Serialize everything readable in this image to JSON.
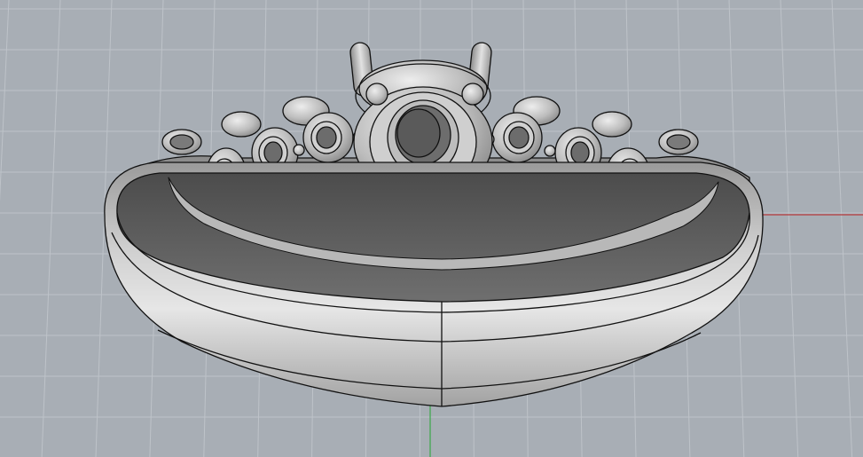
{
  "viewport": {
    "background": "#a8aeb5",
    "grid": true,
    "grid_color": "#bec3c9",
    "x_axis_color": "#b5383a",
    "y_axis_color": "#3aa84a"
  },
  "model": {
    "name": "solitaire-ring-with-side-stones",
    "shade_light": "#dcdcdc",
    "shade_mid": "#bdbdbd",
    "shade_dark": "#5c5c5c",
    "edge_color": "#111111"
  }
}
